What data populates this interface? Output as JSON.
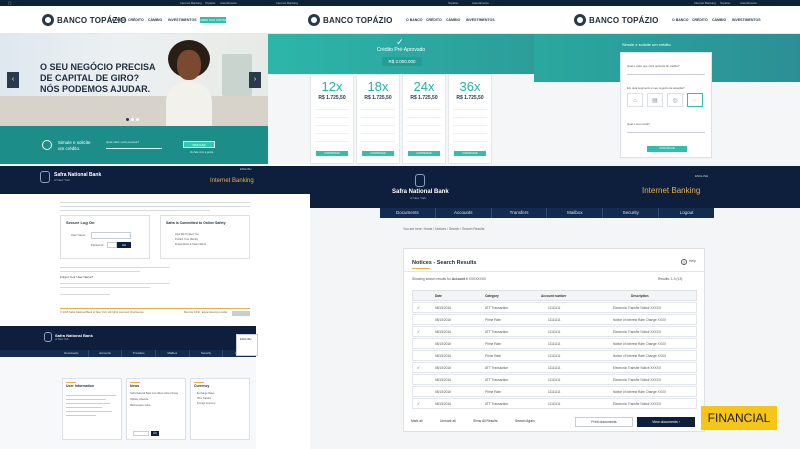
{
  "banco": {
    "brand": "BANCO TOPÁZIO",
    "topbar": {
      "internet": "Internet Banking",
      "cambio": "Topázio",
      "atendimento": "Atendimento"
    },
    "nav": [
      "O BANCO",
      "CRÉDITO",
      "CÂMBIO",
      "INVESTIMENTOS"
    ],
    "nav_cta": "ABRA SUA CONTA",
    "hero": {
      "line1": "O SEU NEGÓCIO PRECISA",
      "line2": "DE CAPITAL DE GIRO?",
      "line3": "NÓS PODEMOS AJUDAR."
    },
    "simule": {
      "line1": "Simule e solicite",
      "line2": "um crédito.",
      "label": "Qual valor você precisa?",
      "button": "SIMULAR",
      "link": "Ou fale com a gente"
    },
    "credito": {
      "title": "Crédito Pré-Aprovado",
      "amount": "R$ 2.000.000"
    },
    "cards": [
      {
        "n": "12x",
        "price": "R$ 1.725,50"
      },
      {
        "n": "18x",
        "price": "R$ 1.725,50"
      },
      {
        "n": "24x",
        "price": "R$ 1.725,50"
      },
      {
        "n": "36x",
        "price": "R$ 1.725,50"
      }
    ],
    "card_button": "CONTRATAR",
    "form": {
      "title": "Simule e solicite um crédito",
      "q1": "Qual o valor que você gostaria de crédito?",
      "q2": "Em qual segmento é seu negócio de atuação?",
      "q3": "Qual o seu email?",
      "button": "CONTINUAR"
    }
  },
  "safra": {
    "name": "Safra National Bank",
    "sub": "of New York",
    "ib": "Internet Banking",
    "lang": "ENGLISH",
    "nav": [
      "Documents",
      "Accounts",
      "Transfers",
      "Mailbox",
      "Security",
      "Logout"
    ],
    "login": {
      "secure": "Secure Log On",
      "user": "User Name",
      "password": "Password",
      "go": "GO",
      "committed": "Safra is Committed to Online Safety",
      "tips": [
        "How We Protect You",
        "Protect Your Identity",
        "Fraud Alerts & Scam Alerts"
      ],
      "forgot": "Forgot Your User Name?",
      "footer": "© 2015 Safra National Bank of New York. All rights reserved. Disclosures",
      "footer_right": "Member FDIC. Equal Housing Lender."
    },
    "dash": {
      "user": "User Information",
      "news": "News",
      "currency": "Currency",
      "go": "GO",
      "news_items": [
        "Safra National Bank now offers online bill pay",
        "Holiday schedule",
        "Maintenance notice"
      ],
      "currency_items": [
        "Exchange Rates",
        "Wire Transfer",
        "Foreign Currency"
      ]
    },
    "notices": {
      "breadcrumb": "You are here: Home / Notices / Search / Search Results",
      "title": "Notices - Search Results",
      "help": "Help",
      "showing_prefix": "Showing search results for",
      "account_label": "Account #",
      "account": "XXXXXXXX",
      "results": "Results: 1-9 (13)",
      "headers": [
        "Date",
        "Category",
        "Account number",
        "Description"
      ],
      "rows": [
        {
          "check": true,
          "date": "08/15/2016",
          "cat": "ATT Transaction",
          "acc": "11111111",
          "desc": "Electronic Transfer Notice XXXXX"
        },
        {
          "check": false,
          "date": "08/15/2016",
          "cat": "Prime Rate",
          "acc": "11111111",
          "desc": "Notice of Interest Rate Change XXXX"
        },
        {
          "check": true,
          "date": "08/15/2016",
          "cat": "ATT Transaction",
          "acc": "11111111",
          "desc": "Electronic Transfer Notice XXXXX"
        },
        {
          "check": false,
          "date": "08/15/2016",
          "cat": "Prime Rate",
          "acc": "11111111",
          "desc": "Notice of Interest Rate Change XXXX"
        },
        {
          "check": false,
          "date": "08/15/2016",
          "cat": "Prime Rate",
          "acc": "11111111",
          "desc": "Notice of Interest Rate Change XXXX"
        },
        {
          "check": true,
          "date": "08/15/2016",
          "cat": "ATT Transaction",
          "acc": "11111111",
          "desc": "Electronic Transfer Notice XXXXX"
        },
        {
          "check": false,
          "date": "08/15/2016",
          "cat": "ATT Transaction",
          "acc": "11111111",
          "desc": "Electronic Transfer Notice XXXXX"
        },
        {
          "check": false,
          "date": "08/15/2016",
          "cat": "Prime Rate",
          "acc": "11111111",
          "desc": "Notice of Interest Rate Change XXXX"
        },
        {
          "check": true,
          "date": "08/15/2016",
          "cat": "ATT Transaction",
          "acc": "11111111",
          "desc": "Electronic Transfer Notice XXXXX"
        }
      ],
      "mark_all": "Mark all",
      "unmark_all": "Unmark all",
      "show_all": "Show All Results",
      "search_again": "Search Again",
      "print": "Print documents",
      "view": "View documents"
    }
  },
  "tag": "FINANCIAL",
  "colors": {
    "teal": "#2fbfab",
    "navy": "#0d1f3c",
    "tag": "#f5c518"
  }
}
